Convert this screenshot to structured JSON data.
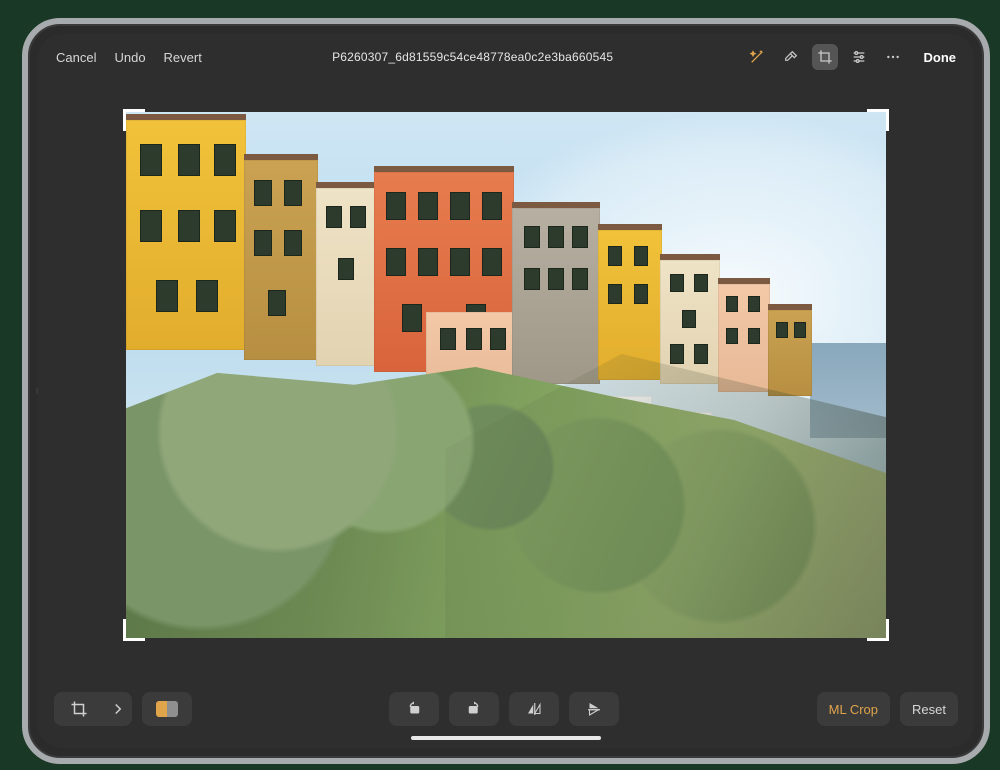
{
  "header": {
    "cancel": "Cancel",
    "undo": "Undo",
    "revert": "Revert",
    "title": "P6260307_6d81559c54ce48778ea0c2e3ba660545",
    "done": "Done"
  },
  "bottom": {
    "ml_crop": "ML Crop",
    "reset": "Reset"
  },
  "colors": {
    "accent": "#e0a44b"
  }
}
